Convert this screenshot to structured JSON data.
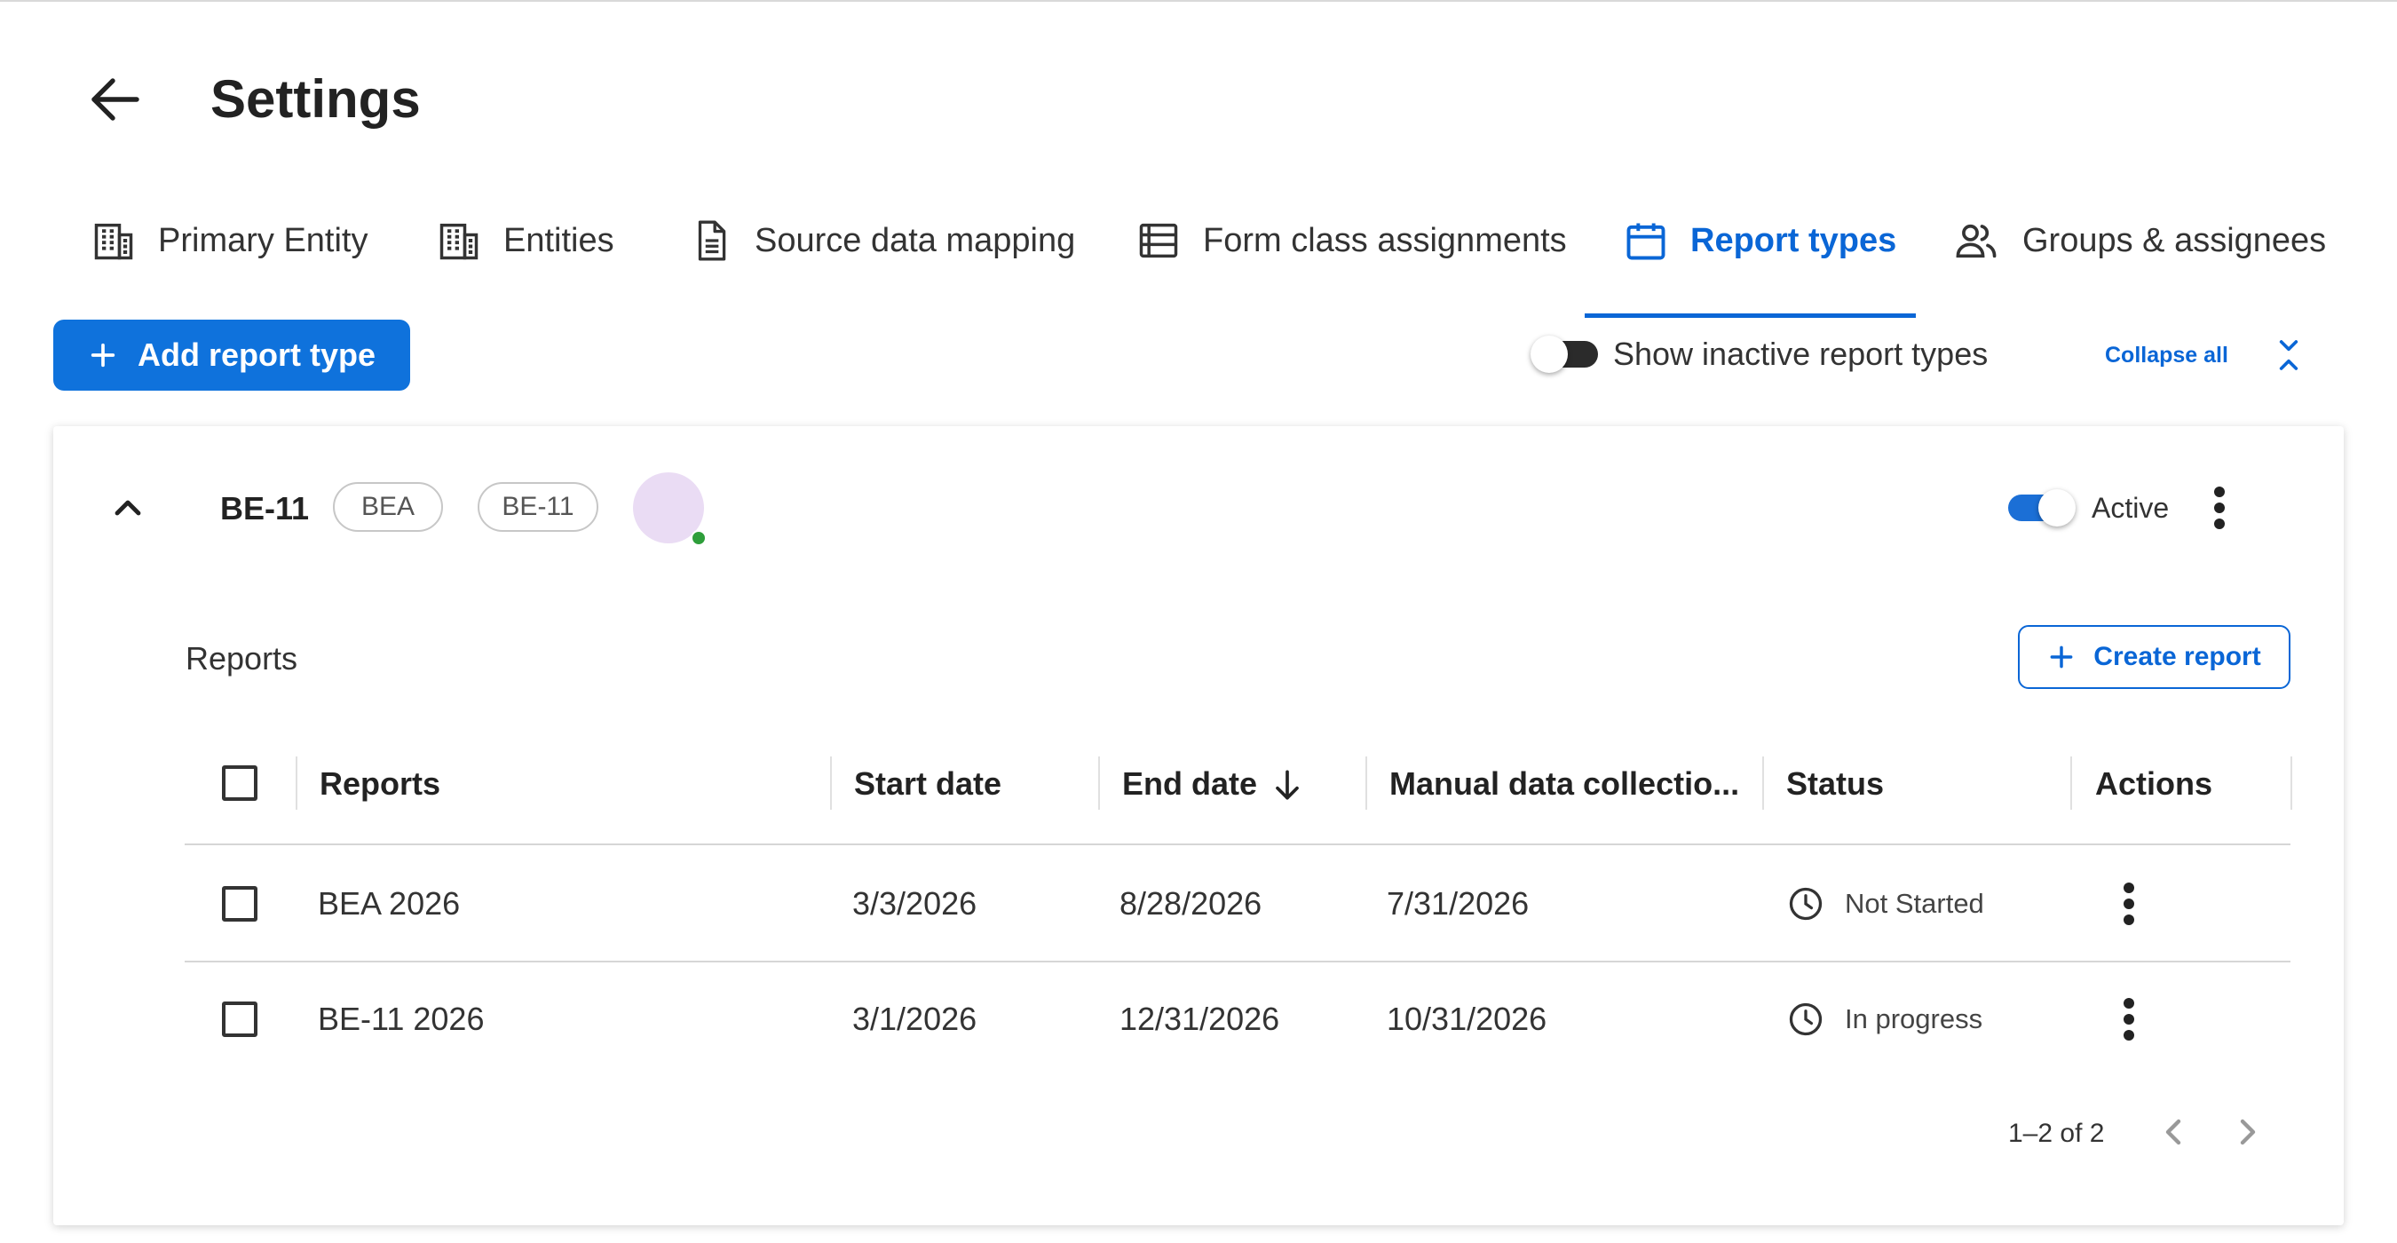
{
  "header": {
    "title": "Settings"
  },
  "tabs": [
    {
      "label": "Primary Entity",
      "icon": "building-icon"
    },
    {
      "label": "Entities",
      "icon": "building-icon"
    },
    {
      "label": "Source data mapping",
      "icon": "document-icon"
    },
    {
      "label": "Form class assignments",
      "icon": "list-icon"
    },
    {
      "label": "Report types",
      "icon": "calendar-icon",
      "active": true
    },
    {
      "label": "Groups & assignees",
      "icon": "people-icon"
    }
  ],
  "toolbar": {
    "add_label": "Add report type",
    "inactive_toggle_label": "Show inactive report types",
    "inactive_toggle_on": false,
    "collapse_label": "Collapse all"
  },
  "report_type": {
    "name": "BE-11",
    "chips": [
      "BEA",
      "BE-11"
    ],
    "active_label": "Active",
    "active_on": true,
    "reports_label": "Reports",
    "create_label": "Create report",
    "table": {
      "columns": [
        "Reports",
        "Start date",
        "End date",
        "Manual data collectio...",
        "Status",
        "Actions"
      ],
      "sort_column": "End date",
      "sort_direction": "descending",
      "rows": [
        {
          "report": "BEA 2026",
          "start": "3/3/2026",
          "end": "8/28/2026",
          "manual": "7/31/2026",
          "status": "Not Started"
        },
        {
          "report": "BE-11 2026",
          "start": "3/1/2026",
          "end": "12/31/2026",
          "manual": "10/31/2026",
          "status": "In progress"
        }
      ]
    },
    "pagination": "1–2 of 2"
  },
  "colors": {
    "accent": "#0a66d6",
    "primary_button": "#0f72dc",
    "avatar": "#eadcf4",
    "presence": "#2e9e3a"
  }
}
